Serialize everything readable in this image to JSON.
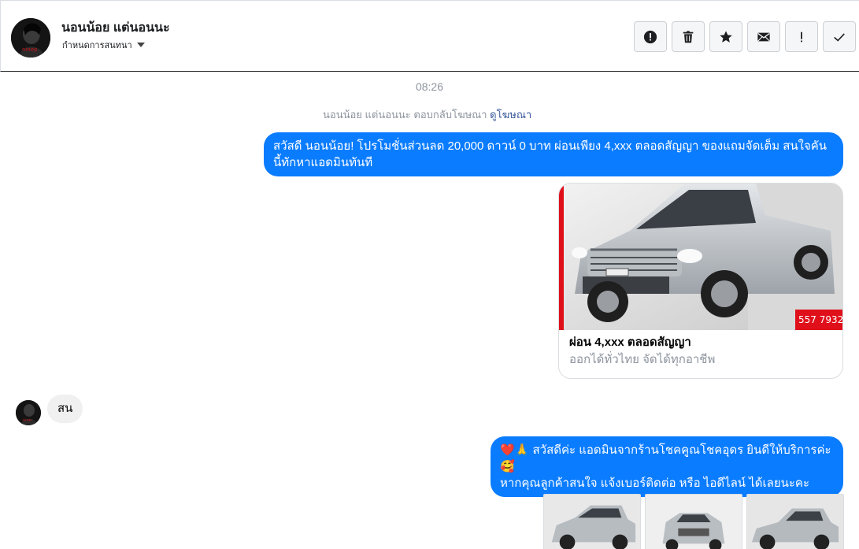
{
  "header": {
    "contact_name": "นอนน้อย แต่นอนนะ",
    "manage_label": "กำหนดการสนทนา",
    "toolbar": [
      {
        "name": "report-button",
        "icon": "alert-circle-icon",
        "label": "!"
      },
      {
        "name": "delete-button",
        "icon": "trash-icon"
      },
      {
        "name": "star-button",
        "icon": "star-icon"
      },
      {
        "name": "mark-unread-button",
        "icon": "envelope-icon"
      },
      {
        "name": "mark-spam-button",
        "icon": "exclamation-icon",
        "label": "!"
      },
      {
        "name": "done-button",
        "icon": "check-icon"
      }
    ]
  },
  "chat": {
    "timestamp": "08:26",
    "reply_note": "นอนน้อย แต่นอนนะ ตอบกลับโฆษณา",
    "reply_note_link": "ดูโฆษณา",
    "message_1": "สวัสดี นอนน้อย! โปรโมชั่นส่วนลด 20,000 ดาวน์ 0 บาท ผ่อนเพียง 4,xxx ตลอดสัญญา ของแถมจัดเต็ม สนใจคันนี้ทักหาแอดมินทันที",
    "ad_card": {
      "title": "ผ่อน 4,xxx ตลอดสัญญา",
      "subtitle": "ออกได้ทั่วไทย จัดได้ทุกอาชีพ",
      "phone_fragment": "557 7932"
    },
    "incoming_message": "สน",
    "message_2_line1": "❤️🙏 สวัสดีค่ะ แอดมินจากร้านโชคคูณโชคอุดร ยินดีให้บริการค่ะ🥰",
    "message_2_line2": "หากคุณลูกค้าสนใจ แจ้งเบอร์ติดต่อ หรือ ไอดีไลน์ ได้เลยนะคะ",
    "thumbnails": 3
  },
  "colors": {
    "accent": "#0a7cff",
    "incoming_bubble": "#f0f0f0",
    "muted_text": "#8d949e",
    "link": "#385898"
  }
}
